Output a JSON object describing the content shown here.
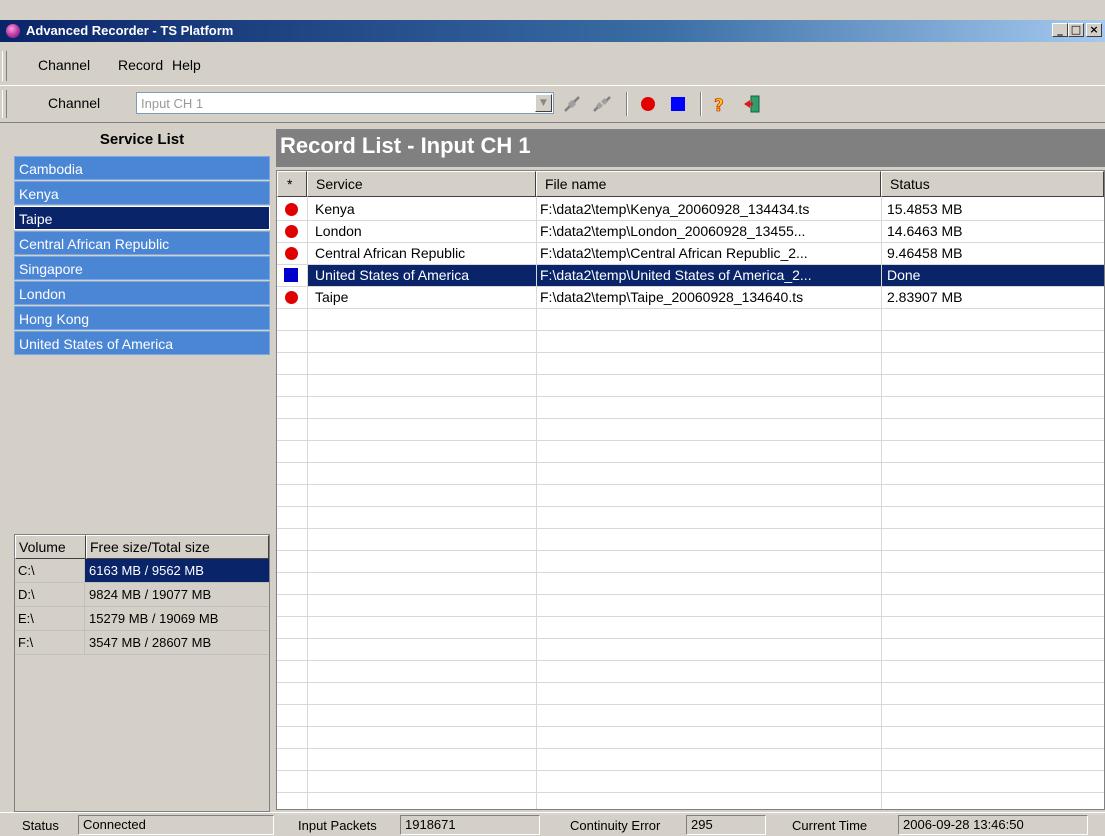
{
  "window": {
    "title": "Advanced Recorder - TS Platform",
    "min_glyph": "_",
    "max_glyph": "□",
    "close_glyph": "×"
  },
  "menu": {
    "items": [
      "Channel",
      "Record",
      "Help"
    ]
  },
  "toolbar": {
    "channel_label": "Channel",
    "channel_value": "Input CH 1",
    "icons": [
      "connect-icon",
      "disconnect-icon",
      "record-icon",
      "stop-icon",
      "help-icon",
      "exit-icon"
    ]
  },
  "service_list": {
    "title": "Service List",
    "items": [
      "Cambodia",
      "Kenya",
      "Taipe",
      "Central African Republic",
      "Singapore",
      "London",
      "Hong Kong",
      "United States of America"
    ],
    "selected": "Taipe"
  },
  "volumes": {
    "headers": [
      "Volume",
      "Free size/Total size"
    ],
    "rows": [
      {
        "volume": "C:\\",
        "size": "6163 MB / 9562 MB",
        "selected": true
      },
      {
        "volume": "D:\\",
        "size": "9824 MB / 19077 MB"
      },
      {
        "volume": "E:\\",
        "size": "15279 MB / 19069 MB"
      },
      {
        "volume": "F:\\",
        "size": "3547 MB / 28607 MB"
      }
    ]
  },
  "record_list": {
    "title": "Record List - Input CH 1",
    "headers": [
      "*",
      "Service",
      "File name",
      "Status"
    ],
    "rows": [
      {
        "marker": "record",
        "service": "Kenya",
        "file": "F:\\data2\\temp\\Kenya_20060928_134434.ts",
        "status": "15.4853 MB"
      },
      {
        "marker": "record",
        "service": "London",
        "file": "F:\\data2\\temp\\London_20060928_13455...",
        "status": "14.6463 MB"
      },
      {
        "marker": "record",
        "service": "Central African Republic",
        "file": "F:\\data2\\temp\\Central African Republic_2...",
        "status": "9.46458 MB"
      },
      {
        "marker": "stop",
        "service": "United States of America",
        "file": "F:\\data2\\temp\\United States of America_2...",
        "status": "Done",
        "selected": true
      },
      {
        "marker": "record",
        "service": "Taipe",
        "file": "F:\\data2\\temp\\Taipe_20060928_134640.ts",
        "status": "2.83907 MB"
      }
    ]
  },
  "status_bar": {
    "status_label": "Status",
    "status_value": "Connected",
    "packets_label": "Input Packets",
    "packets_value": "1918671",
    "cont_label": "Continuity Error",
    "cont_value": "295",
    "time_label": "Current Time",
    "time_value": "2006-09-28 13:46:50"
  },
  "colors": {
    "record": "#e00000",
    "stop": "#0000cc",
    "selection": "#0a246a",
    "service_item": "#4a86d4"
  }
}
